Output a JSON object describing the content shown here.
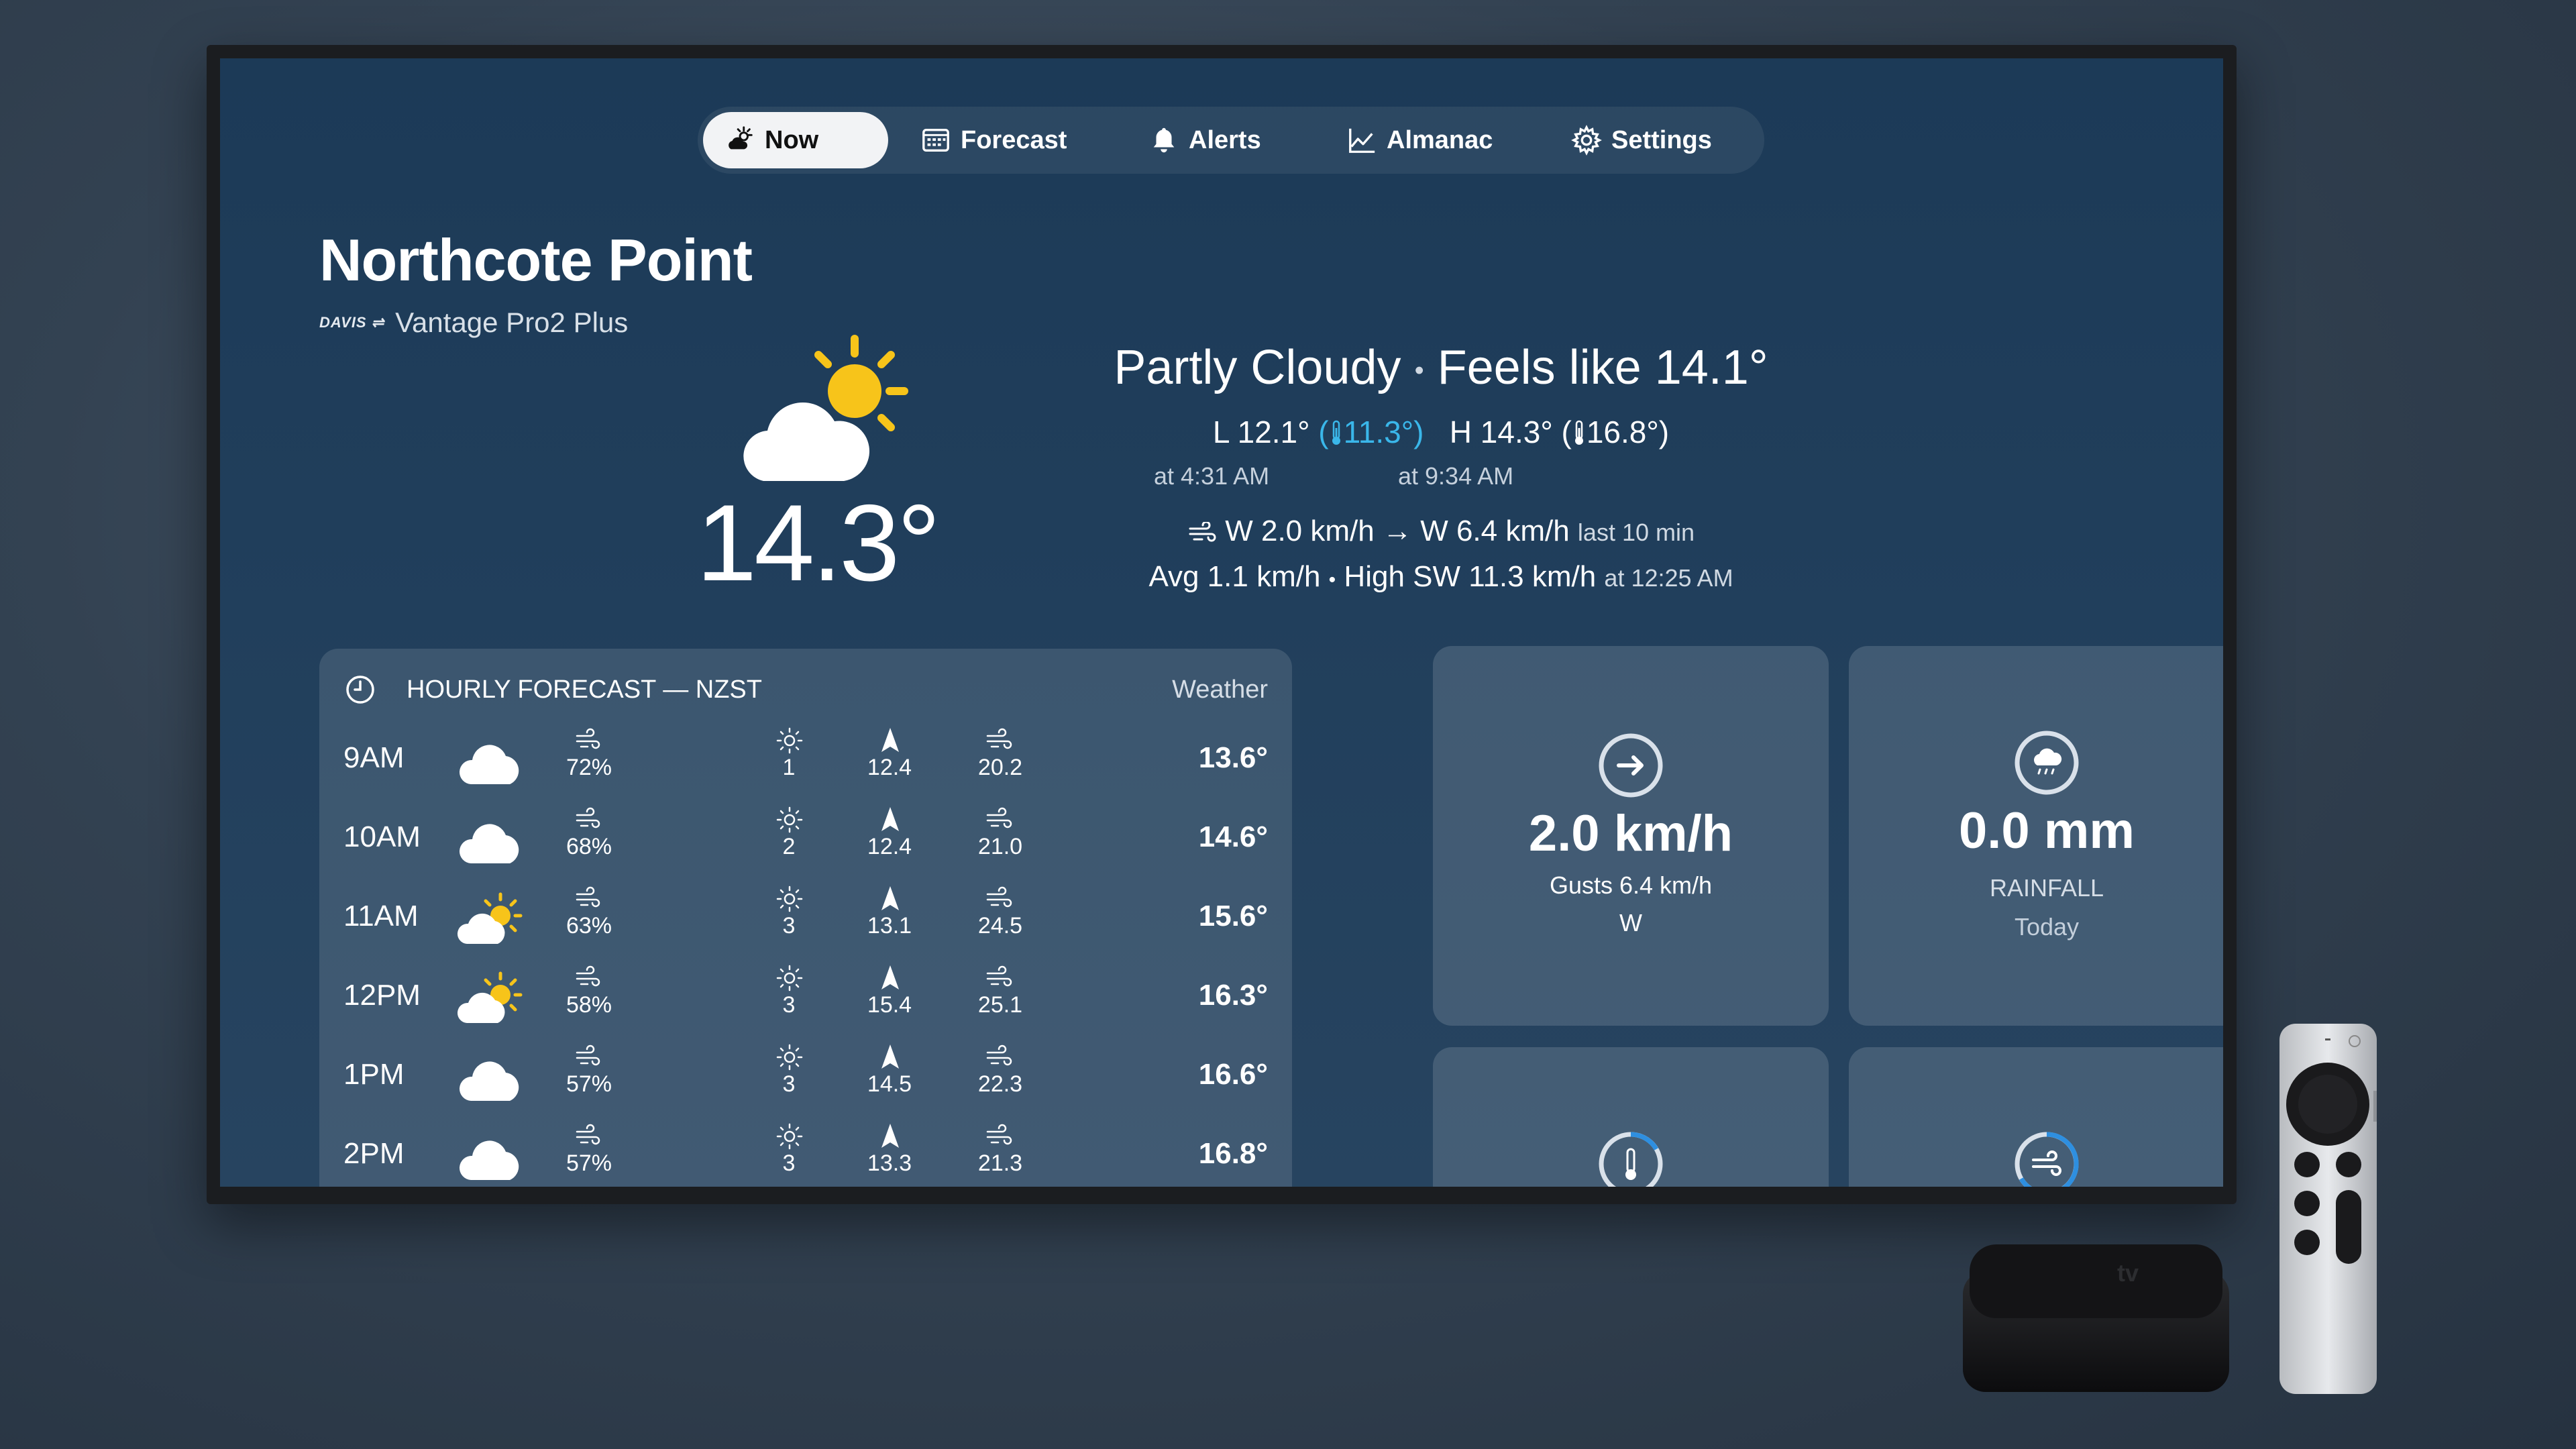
{
  "nav": {
    "items": [
      {
        "label": "Now",
        "icon": "partly-sunny-icon",
        "active": true
      },
      {
        "label": "Forecast",
        "icon": "calendar-icon",
        "active": false
      },
      {
        "label": "Alerts",
        "icon": "bell-icon",
        "active": false
      },
      {
        "label": "Almanac",
        "icon": "chart-line-icon",
        "active": false
      },
      {
        "label": "Settings",
        "icon": "gear-icon",
        "active": false
      }
    ]
  },
  "location": {
    "name": "Northcote Point",
    "brand_logo": "DAVIS",
    "station": "Vantage Pro2 Plus"
  },
  "current": {
    "temperature": "14.3°",
    "condition": "Partly Cloudy",
    "separator": "•",
    "feels_like": "Feels like 14.1°",
    "low_label": "L 12.1°",
    "low_feels": "11.3°)",
    "low_feels_open": "(",
    "high_label": "H 14.3°",
    "high_feels": "16.8°)",
    "high_feels_open": "(",
    "low_time": "at 4:31 AM",
    "high_time": "at 9:34 AM",
    "wind_now": "W 2.0 km/h",
    "wind_arrow": "→",
    "wind_10min": "W 6.4 km/h",
    "wind_10min_suffix": "last 10 min",
    "wind_avg": "Avg 1.1 km/h",
    "wind_high": "High SW 11.3 km/h",
    "wind_high_time": "at 12:25 AM",
    "icon": "partly-cloudy-sun-icon"
  },
  "hourly": {
    "title": "HOURLY FORECAST — NZST",
    "brand": "Weather",
    "rows": [
      {
        "time": "9AM",
        "icon": "cloud",
        "humidity": "72%",
        "uv": "1",
        "wind_speed": "12.4",
        "gust": "20.2",
        "temp": "13.6°"
      },
      {
        "time": "10AM",
        "icon": "cloud",
        "humidity": "68%",
        "uv": "2",
        "wind_speed": "12.4",
        "gust": "21.0",
        "temp": "14.6°"
      },
      {
        "time": "11AM",
        "icon": "partly-sunny",
        "humidity": "63%",
        "uv": "3",
        "wind_speed": "13.1",
        "gust": "24.5",
        "temp": "15.6°"
      },
      {
        "time": "12PM",
        "icon": "partly-sunny",
        "humidity": "58%",
        "uv": "3",
        "wind_speed": "15.4",
        "gust": "25.1",
        "temp": "16.3°"
      },
      {
        "time": "1PM",
        "icon": "cloud",
        "humidity": "57%",
        "uv": "3",
        "wind_speed": "14.5",
        "gust": "22.3",
        "temp": "16.6°"
      },
      {
        "time": "2PM",
        "icon": "cloud",
        "humidity": "57%",
        "uv": "3",
        "wind_speed": "13.3",
        "gust": "21.3",
        "temp": "16.8°"
      }
    ]
  },
  "tiles": {
    "wind": {
      "value": "2.0 km/h",
      "gusts": "Gusts 6.4 km/h",
      "direction": "W",
      "icon": "arrow-right-circle-icon"
    },
    "rain": {
      "value": "0.0 mm",
      "label": "RAINFALL",
      "period": "Today",
      "icon": "rain-cloud-icon"
    },
    "temp_tile": {
      "icon": "thermometer-icon"
    },
    "wind_tile": {
      "icon": "wind-icon"
    }
  },
  "colors": {
    "accent_cyan": "#3ab7ea",
    "sun_yellow": "#f7c41a",
    "ring_blue": "#2e8fe0",
    "background": "#203e5b"
  },
  "devices": {
    "box_logo": "tv"
  }
}
